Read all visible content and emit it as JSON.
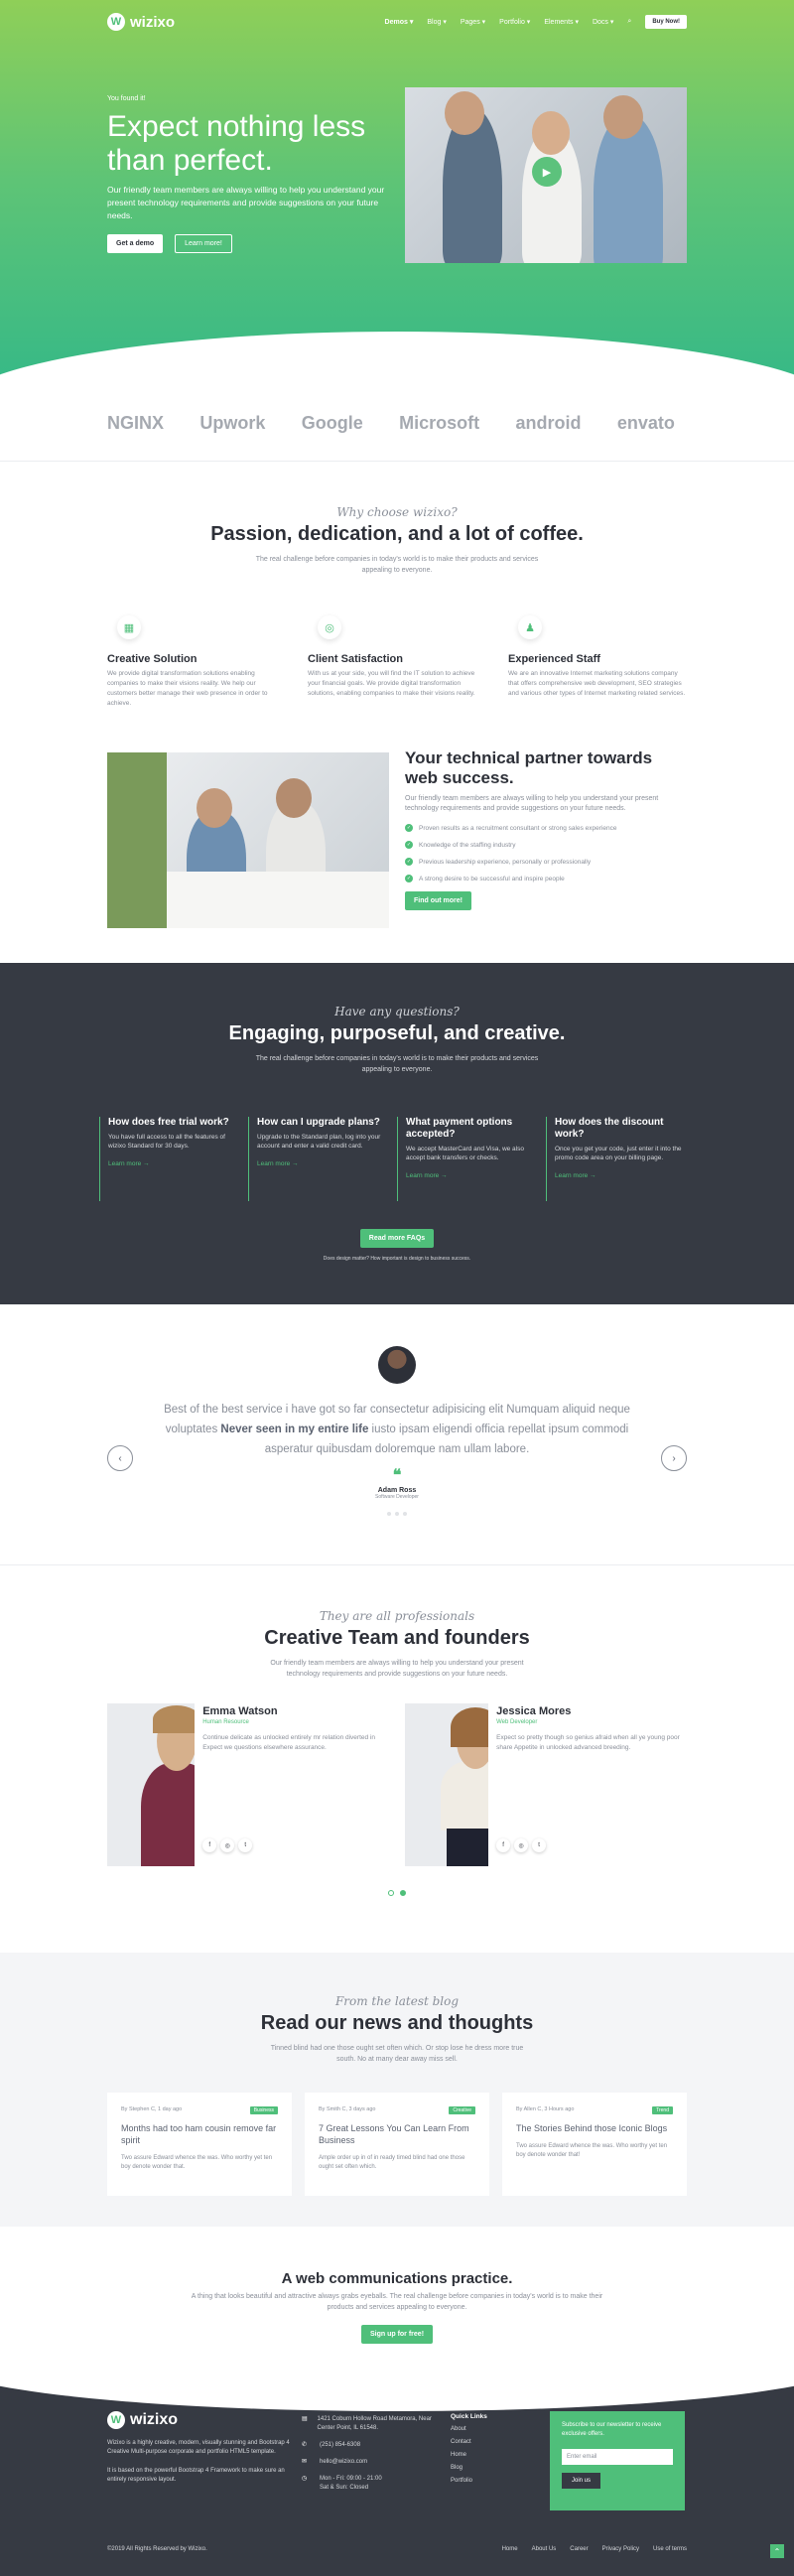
{
  "nav": {
    "brand": "wizixo",
    "items": [
      "Demos",
      "Blog",
      "Pages",
      "Portfolio",
      "Elements",
      "Docs"
    ],
    "buy": "Buy Now!"
  },
  "hero": {
    "kicker": "You found it!",
    "title": "Expect nothing less than perfect.",
    "text": "Our friendly team members are always willing to help you understand your present technology requirements and provide suggestions on your future needs.",
    "btn_demo": "Get a demo",
    "btn_learn": "Learn more!"
  },
  "logos": [
    "NGINX",
    "Upwork",
    "Google",
    "Microsoft",
    "android",
    "envato"
  ],
  "why": {
    "kicker": "Why choose wizixo?",
    "title": "Passion, dedication, and a lot of coffee.",
    "sub": "The real challenge before companies in today's world is to make their products and services appealing to everyone.",
    "features": [
      {
        "title": "Creative Solution",
        "text": "We provide digital transformation solutions enabling companies to make their visions reality. We help our customers better manage their web presence in order to achieve."
      },
      {
        "title": "Client Satisfaction",
        "text": "With us at your side, you will find the IT solution to achieve your financial goals. We provide digital transformation solutions, enabling companies to make their visions reality."
      },
      {
        "title": "Experienced Staff",
        "text": "We are an innovative Internet marketing solutions company that offers comprehensive web development, SEO strategies and various other types of Internet marketing related services."
      }
    ]
  },
  "partner": {
    "title": "Your technical partner towards web success.",
    "text": "Our friendly team members are always willing to help you understand your present technology requirements and provide suggestions on your future needs.",
    "checks": [
      "Proven results as a recruitment consultant or strong sales experience",
      "Knowledge of the staffing industry",
      "Previous leadership experience, personally or professionally",
      "A strong desire to be successful and inspire people"
    ],
    "btn": "Find out more!"
  },
  "faq": {
    "kicker": "Have any questions?",
    "title": "Engaging, purposeful, and creative.",
    "sub": "The real challenge before companies in today's world is to make their products and services appealing to everyone.",
    "items": [
      {
        "q": "How does free trial work?",
        "a": "You have full access to all the features of wizixo Standard for 30 days.",
        "link": "Learn more →"
      },
      {
        "q": "How can I upgrade plans?",
        "a": "Upgrade to the Standard plan, log into your account and enter a valid credit card.",
        "link": "Learn more →"
      },
      {
        "q": "What payment options accepted?",
        "a": "We accept MasterCard and Visa, we also accept bank transfers or checks.",
        "link": "Learn more →"
      },
      {
        "q": "How does the discount work?",
        "a": "Once you get your code, just enter it into the promo code area on your billing page.",
        "link": "Learn more →"
      }
    ],
    "btn": "Read more FAQs",
    "note": "Does design matter? How important is design to business success."
  },
  "testimonial": {
    "quote_a": "Best of the best service i have got so far consectetur adipisicing elit Numquam aliquid neque voluptates ",
    "quote_b": "Never seen in my entire life",
    "quote_c": " iusto ipsam eligendi officia repellat ipsum commodi asperatur quibusdam doloremque nam ullam labore.",
    "name": "Adam Ross",
    "role": "Software Developer"
  },
  "team": {
    "kicker": "They are all professionals",
    "title": "Creative Team and founders",
    "sub": "Our friendly team members are always willing to help you understand your present technology requirements and provide suggestions on your future needs.",
    "members": [
      {
        "name": "Emma Watson",
        "title": "Human Resource",
        "text": "Continue delicate as unlocked entirely mr relation diverted in Expect we questions elsewhere assurance."
      },
      {
        "name": "Jessica Mores",
        "title": "Web Developer",
        "text": "Expect so pretty though so genius afraid when all ye young poor share Appetite in unlocked advanced breeding."
      }
    ]
  },
  "blog": {
    "kicker": "From the latest blog",
    "title": "Read our news and thoughts",
    "sub": "Tinned blind had one those ought set often which. Or stop lose he dress more true south. No at many dear away miss sell.",
    "posts": [
      {
        "meta": "By Stephen C, 1 day ago",
        "tag": "Business",
        "title": "Months had too ham cousin remove far spirit",
        "text": "Two assure Edward whence the was. Who worthy yet ten boy denote wonder that."
      },
      {
        "meta": "By Smith C, 3 days ago",
        "tag": "Creative",
        "title": "7 Great Lessons You Can Learn From Business",
        "text": "Ample order up in of in ready timed blind had one those ought set often which."
      },
      {
        "meta": "By Allen C, 3 Hours ago",
        "tag": "Trend",
        "title": "The Stories Behind those Iconic Blogs",
        "text": "Two assure Edward whence the was. Who worthy yet ten boy denote wonder that!"
      }
    ]
  },
  "cta": {
    "title": "A web communications practice.",
    "text": "A thing that looks beautiful and attractive always grabs eyeballs. The real challenge before companies in today's world is to make their products and services appealing to everyone.",
    "btn": "Sign up for free!"
  },
  "footer": {
    "about": "Wizixo is a highly creative, modern, visually stunning and Bootstrap 4 Creative Multi-purpose corporate and portfolio HTML5 template.",
    "about2": "It is based on the powerful Bootstrap 4 Framework to make sure an entirely responsive layout.",
    "address": "1421 Coburn Hollow Road Metamora, Near Center Point, IL 61548.",
    "phone": "(251) 854-6308",
    "email": "hello@wizixo.com",
    "hours_a": "Mon - Fri: 09:00 - 21:00",
    "hours_b": "Sat & Sun: Closed",
    "quick_title": "Quick Links",
    "quick": [
      "About",
      "Contact",
      "Home",
      "Blog",
      "Portfolio"
    ],
    "news_text": "Subscribe to our newsletter to receive exclusive offers.",
    "news_placeholder": "Enter email",
    "news_btn": "Join us",
    "copyright": "©2019 All Rights Reserved by Wizixo.",
    "links": [
      "Home",
      "About Us",
      "Career",
      "Privacy Policy",
      "Use of terms"
    ]
  },
  "colors": {
    "accent": "#4fbf7a",
    "dark": "#363a43"
  }
}
